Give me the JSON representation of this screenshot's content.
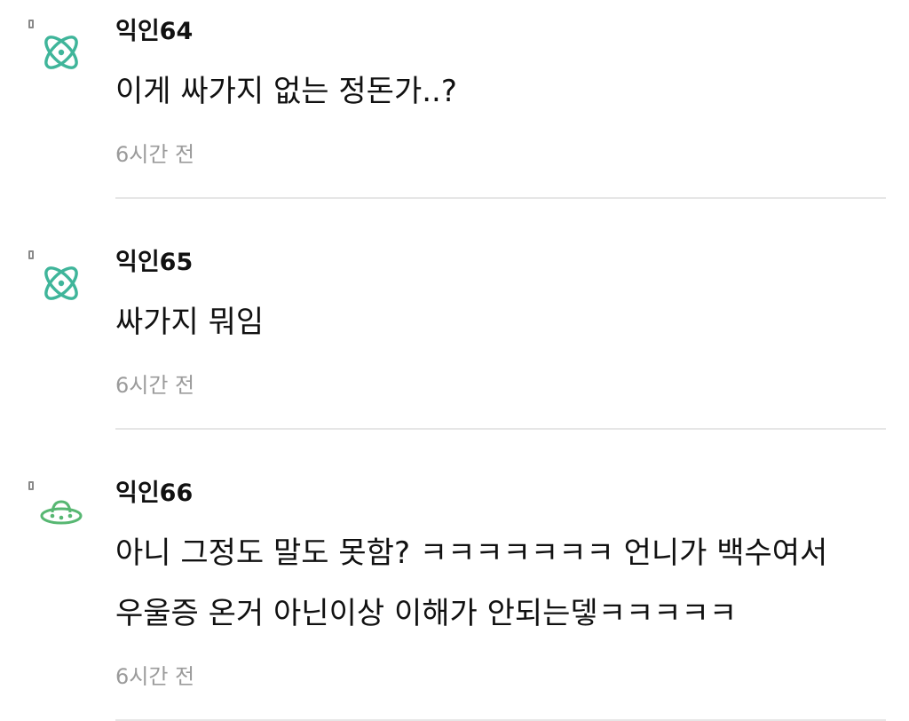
{
  "colors": {
    "avatar_teal": "#3fb59a",
    "avatar_green": "#57b772",
    "time_gray": "#9b9b9b",
    "divider_gray": "#e6e6e6"
  },
  "comments": [
    {
      "author": "익인64",
      "avatar_icon": "atom-icon",
      "lines": [
        "이게 싸가지 없는 정돈가..?"
      ],
      "time": "6시간 전"
    },
    {
      "author": "익인65",
      "avatar_icon": "atom-icon",
      "lines": [
        "싸가지 뭐임"
      ],
      "time": "6시간 전"
    },
    {
      "author": "익인66",
      "avatar_icon": "ufo-icon",
      "lines": [
        "아니 그정도 말도 못함? ㅋㅋㅋㅋㅋㅋㅋ 언니가 백수여서",
        "우울증 온거 아닌이상 이해가 안되는뎋ㅋㅋㅋㅋㅋ"
      ],
      "time": "6시간 전"
    }
  ]
}
